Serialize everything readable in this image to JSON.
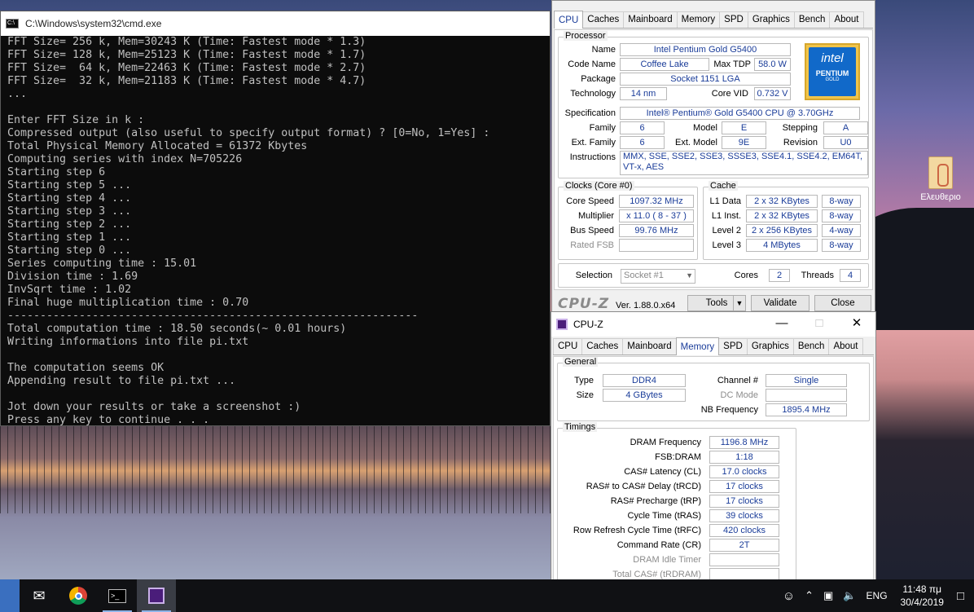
{
  "desktop": {
    "icon_label": "Ελευθεριο"
  },
  "cmd": {
    "title": "C:\\Windows\\system32\\cmd.exe",
    "icon_text": "C:\\",
    "lines": [
      "FFT Size= 256 k, Mem=30243 K (Time: Fastest mode * 1.3)",
      "FFT Size= 128 k, Mem=25123 K (Time: Fastest mode * 1.7)",
      "FFT Size=  64 k, Mem=22463 K (Time: Fastest mode * 2.7)",
      "FFT Size=  32 k, Mem=21183 K (Time: Fastest mode * 4.7)",
      "...",
      "",
      "Enter FFT Size in k :",
      "Compressed output (also useful to specify output format) ? [0=No, 1=Yes] :",
      "Total Physical Memory Allocated = 61372 Kbytes",
      "Computing series with index N=705226",
      "Starting step 6",
      "Starting step 5 ...",
      "Starting step 4 ...",
      "Starting step 3 ...",
      "Starting step 2 ...",
      "Starting step 1 ...",
      "Starting step 0 ...",
      "Series computing time : 15.01",
      "Division time : 1.69",
      "InvSqrt time : 1.02",
      "Final huge multiplication time : 0.70",
      "---------------------------------------------------------------",
      "Total computation time : 18.50 seconds(~ 0.01 hours)",
      "Writing informations into file pi.txt",
      "",
      "The computation seems OK",
      "Appending result to file pi.txt ...",
      "",
      "Jot down your results or take a screenshot :)",
      "Press any key to continue . . ."
    ]
  },
  "tabs": [
    "CPU",
    "Caches",
    "Mainboard",
    "Memory",
    "SPD",
    "Graphics",
    "Bench",
    "About"
  ],
  "cpu_window": {
    "processor": {
      "group": "Processor",
      "name_label": "Name",
      "name": "Intel Pentium Gold G5400",
      "codename_label": "Code Name",
      "codename": "Coffee Lake",
      "tdp_label": "Max TDP",
      "tdp": "58.0 W",
      "package_label": "Package",
      "package": "Socket 1151 LGA",
      "tech_label": "Technology",
      "tech": "14 nm",
      "vid_label": "Core VID",
      "vid": "0.732 V",
      "spec_label": "Specification",
      "spec": "Intel® Pentium® Gold G5400 CPU @ 3.70GHz",
      "family_label": "Family",
      "family": "6",
      "model_label": "Model",
      "model": "E",
      "stepping_label": "Stepping",
      "stepping": "A",
      "extfamily_label": "Ext. Family",
      "extfamily": "6",
      "extmodel_label": "Ext. Model",
      "extmodel": "9E",
      "revision_label": "Revision",
      "revision": "U0",
      "instr_label": "Instructions",
      "instr": "MMX, SSE, SSE2, SSE3, SSSE3, SSE4.1, SSE4.2, EM64T, VT-x, AES",
      "logo_brand": "intel",
      "logo_line1": "PENTIUM",
      "logo_line2": "GOLD"
    },
    "clocks": {
      "group": "Clocks (Core #0)",
      "core_speed_label": "Core Speed",
      "core_speed": "1097.32 MHz",
      "multiplier_label": "Multiplier",
      "multiplier": "x 11.0 ( 8 - 37 )",
      "bus_label": "Bus Speed",
      "bus": "99.76 MHz",
      "fsb_label": "Rated FSB",
      "fsb": ""
    },
    "cache": {
      "group": "Cache",
      "l1d_label": "L1 Data",
      "l1d": "2 x 32 KBytes",
      "l1d_way": "8-way",
      "l1i_label": "L1 Inst.",
      "l1i": "2 x 32 KBytes",
      "l1i_way": "8-way",
      "l2_label": "Level 2",
      "l2": "2 x 256 KBytes",
      "l2_way": "4-way",
      "l3_label": "Level 3",
      "l3": "4 MBytes",
      "l3_way": "8-way"
    },
    "selection_label": "Selection",
    "selection": "Socket #1",
    "cores_label": "Cores",
    "cores": "2",
    "threads_label": "Threads",
    "threads": "4",
    "footer": {
      "logo": "CPU-Z",
      "version": "Ver. 1.88.0.x64",
      "tools": "Tools",
      "validate": "Validate",
      "close": "Close"
    }
  },
  "memory_window": {
    "title": "CPU-Z",
    "general": {
      "group": "General",
      "type_label": "Type",
      "type": "DDR4",
      "size_label": "Size",
      "size": "4 GBytes",
      "channel_label": "Channel #",
      "channel": "Single",
      "dcmode_label": "DC Mode",
      "dcmode": "",
      "nbfreq_label": "NB Frequency",
      "nbfreq": "1895.4 MHz"
    },
    "timings": {
      "group": "Timings",
      "rows": [
        {
          "label": "DRAM Frequency",
          "value": "1196.8 MHz"
        },
        {
          "label": "FSB:DRAM",
          "value": "1:18"
        },
        {
          "label": "CAS# Latency (CL)",
          "value": "17.0 clocks"
        },
        {
          "label": "RAS# to CAS# Delay (tRCD)",
          "value": "17 clocks"
        },
        {
          "label": "RAS# Precharge (tRP)",
          "value": "17 clocks"
        },
        {
          "label": "Cycle Time (tRAS)",
          "value": "39 clocks"
        },
        {
          "label": "Row Refresh Cycle Time (tRFC)",
          "value": "420 clocks"
        },
        {
          "label": "Command Rate (CR)",
          "value": "2T"
        },
        {
          "label": "DRAM Idle Timer",
          "value": ""
        },
        {
          "label": "Total CAS# (tRDRAM)",
          "value": ""
        }
      ]
    }
  },
  "taskbar": {
    "lang": "ENG",
    "time": "11:48 πμ",
    "date": "30/4/2019"
  }
}
